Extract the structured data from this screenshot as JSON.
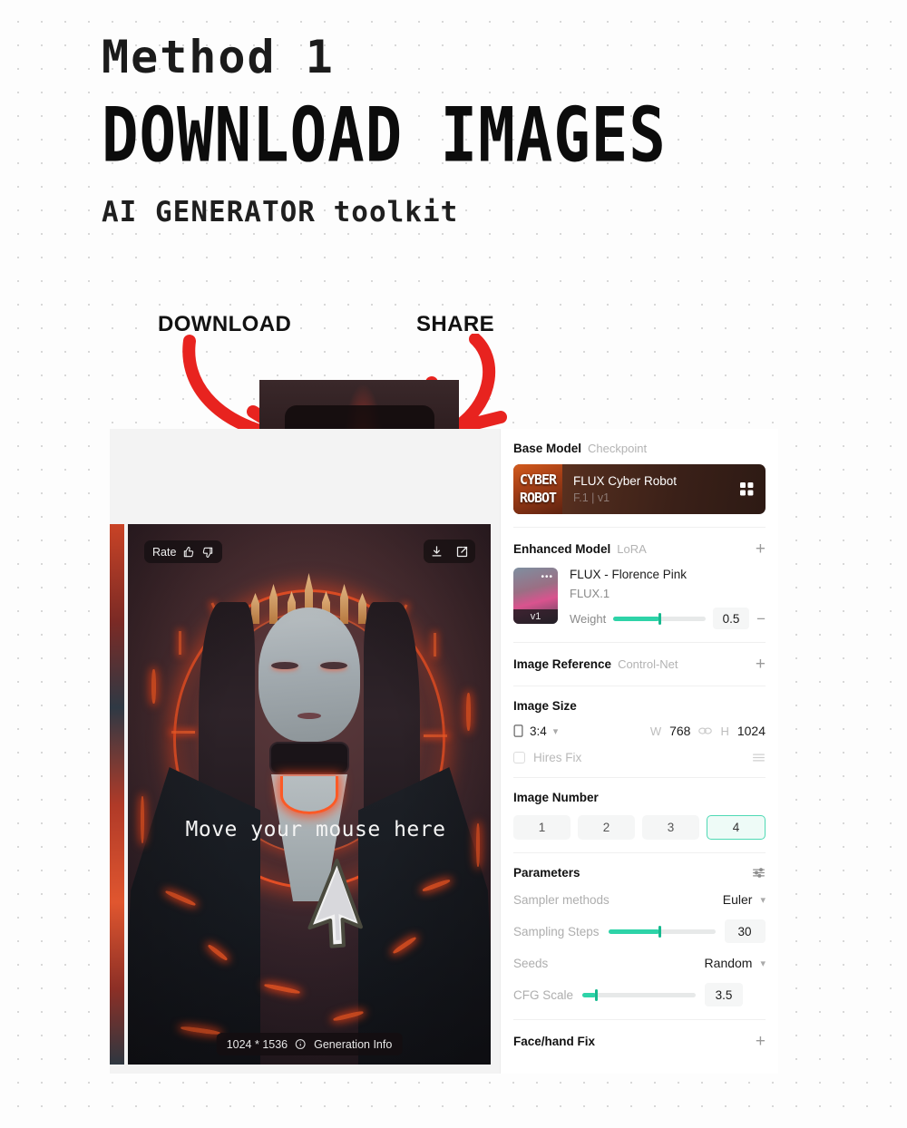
{
  "headline": {
    "method": "Method 1",
    "title": "DOWNLOAD IMAGES",
    "subtitle": "AI GENERATOR toolkit"
  },
  "callouts": {
    "download_label": "DOWNLOAD",
    "share_label": "SHARE",
    "arrow_color": "#e8231f"
  },
  "zoom_callout": {
    "download_icon": "download-icon",
    "share_icon": "share-external-icon"
  },
  "image_card": {
    "rate_label": "Rate",
    "thumb_up_icon": "thumbs-up-icon",
    "thumb_down_icon": "thumbs-down-icon",
    "download_icon": "download-icon",
    "share_icon": "share-external-icon",
    "overlay_text": "Move your mouse here",
    "cursor_icon": "mouse-pointer-cursor",
    "resolution": "1024 * 1536",
    "info_icon": "info-circle-icon",
    "info_label": "Generation Info"
  },
  "panel": {
    "accent_color": "#2ed3a8",
    "base_model": {
      "title": "Base Model",
      "subtitle": "Checkpoint",
      "card_name": "FLUX Cyber Robot",
      "card_version": "F.1 | v1",
      "thumb_line1": "CYBER",
      "thumb_line2": "ROBOT",
      "grid_icon": "grid-squares-icon"
    },
    "enhanced_model": {
      "title": "Enhanced Model",
      "subtitle": "LoRA",
      "add_icon": "plus-icon",
      "item_name": "FLUX - Florence Pink",
      "item_base": "FLUX.1",
      "item_version": "v1",
      "more_icon": "more-dots-icon",
      "weight_label": "Weight",
      "weight_value": "0.5",
      "weight_percent": 50,
      "remove_icon": "minus-icon"
    },
    "image_reference": {
      "title": "Image Reference",
      "subtitle": "Control-Net",
      "add_icon": "plus-icon"
    },
    "image_size": {
      "title": "Image Size",
      "ratio_icon": "portrait-frame-icon",
      "ratio": "3:4",
      "chevron_icon": "chevron-down-icon",
      "w_label": "W",
      "width": "768",
      "link_icon": "link-chain-icon",
      "h_label": "H",
      "height": "1024",
      "hires_label": "Hires Fix",
      "hires_checked": false,
      "hires_settings_icon": "sliders-icon"
    },
    "image_number": {
      "title": "Image Number",
      "options": [
        "1",
        "2",
        "3",
        "4"
      ],
      "selected": "4"
    },
    "parameters": {
      "title": "Parameters",
      "settings_icon": "sliders-icon",
      "sampler_label": "Sampler methods",
      "sampler_value": "Euler",
      "steps_label": "Sampling Steps",
      "steps_value": "30",
      "steps_percent": 48,
      "seeds_label": "Seeds",
      "seeds_value": "Random",
      "cfg_label": "CFG Scale",
      "cfg_value": "3.5",
      "cfg_percent": 12
    },
    "face_hand_fix": {
      "title": "Face/hand Fix",
      "add_icon": "plus-icon"
    }
  }
}
